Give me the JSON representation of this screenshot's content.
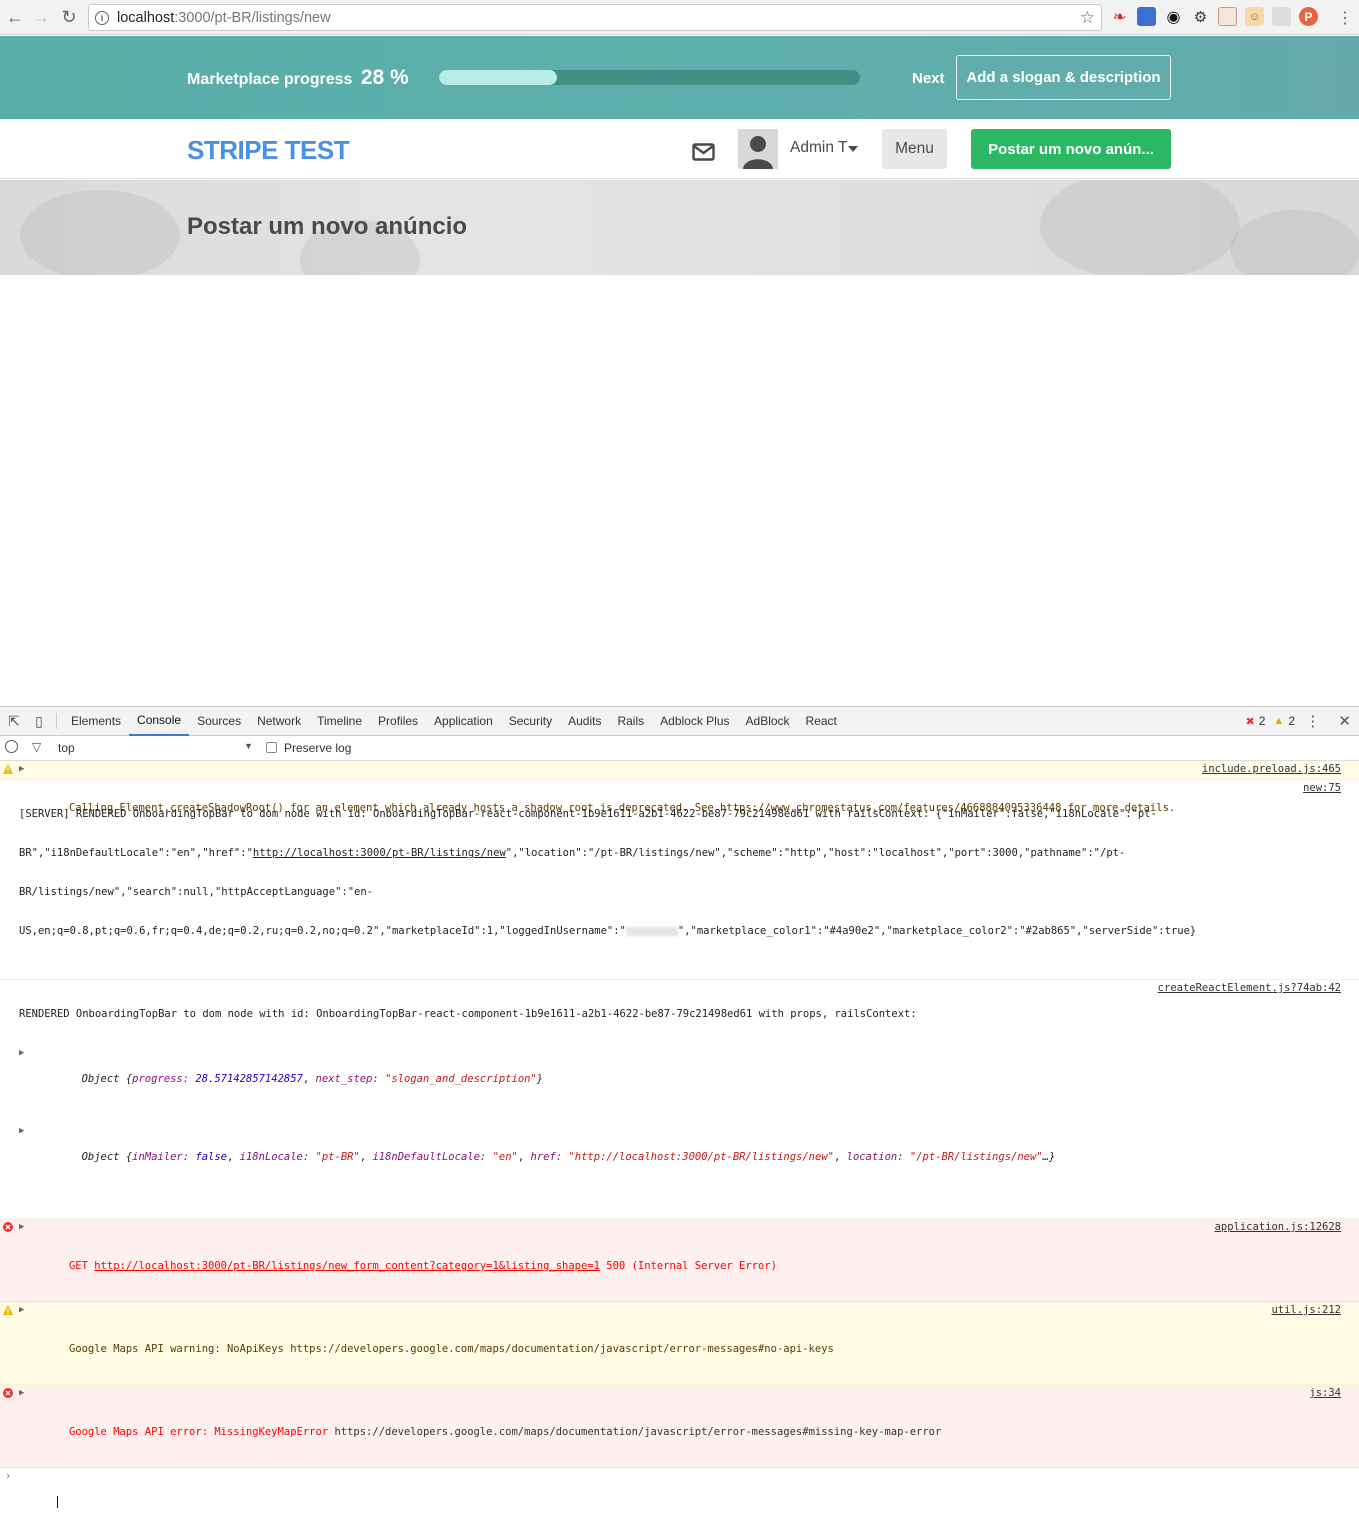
{
  "browser": {
    "url_host": "localhost",
    "url_path": ":3000/pt-BR/listings/new",
    "back_icon": "arrow-left-icon",
    "forward_icon": "arrow-right-icon",
    "reload_icon": "reload-icon",
    "star_icon": "bookmark-star-icon"
  },
  "onboarding": {
    "progress_label": "Marketplace progress",
    "progress_percent_text": "28 %",
    "progress_fraction": 0.28,
    "next_label": "Next",
    "next_step_button": "Add a slogan & description",
    "bar_color": "#58aea8",
    "fill_color": "#b9ece3"
  },
  "topbar": {
    "logo": "STRIPE TEST",
    "logo_color": "#4a90e2",
    "user_name": "Admin T",
    "menu_label": "Menu",
    "post_button": "Postar um novo anún...",
    "post_button_color": "#2ab865"
  },
  "hero": {
    "title": "Postar um novo anúncio"
  },
  "devtools": {
    "tabs": [
      "Elements",
      "Console",
      "Sources",
      "Network",
      "Timeline",
      "Profiles",
      "Application",
      "Security",
      "Audits",
      "Rails",
      "Adblock Plus",
      "AdBlock",
      "React"
    ],
    "active_tab": "Console",
    "error_count": "2",
    "warning_count": "2",
    "context": "top",
    "preserve_log": "Preserve log",
    "messages": {
      "m1": {
        "text": "Calling Element.createShadowRoot() for an element which already hosts a shadow root is deprecated. See https://www.chromestatus.com/features/4668884095336448 for more details.",
        "source": "include.preload.js:465"
      },
      "m2": {
        "line1": "[SERVER] RENDERED OnboardingTopBar to dom node with id: OnboardingTopBar-react-component-1b9e1611-a2b1-4622-be87-79c21498ed61 with railsContext: {\"inMailer\":false,\"i18nLocale\":\"pt-",
        "line2a": "BR\",\"i18nDefaultLocale\":\"en\",\"href\":\"",
        "line2link": "http://localhost:3000/pt-BR/listings/new",
        "line2b": "\",\"location\":\"/pt-BR/listings/new\",\"scheme\":\"http\",\"host\":\"localhost\",\"port\":3000,\"pathname\":\"/pt-",
        "line3": "BR/listings/new\",\"search\":null,\"httpAcceptLanguage\":\"en-",
        "line4a": "US,en;q=0.8,pt;q=0.6,fr;q=0.4,de;q=0.2,ru;q=0.2,no;q=0.2\",\"marketplaceId\":1,\"loggedInUsername\":\"",
        "line4b": "\",\"marketplace_color1\":\"#4a90e2\",\"marketplace_color2\":\"#2ab865\",\"serverSide\":true}",
        "source": "new:75"
      },
      "m3": {
        "text": "RENDERED OnboardingTopBar to dom node with id: OnboardingTopBar-react-component-1b9e1611-a2b1-4622-be87-79c21498ed61 with props, railsContext:",
        "source": "createReactElement.js?74ab:42",
        "obj1_prefix": "Object {",
        "obj1_k1": "progress:",
        "obj1_v1": "28.57142857142857",
        "obj1_k2": "next_step:",
        "obj1_v2": "\"slogan_and_description\"",
        "obj1_suffix": "}",
        "obj2_prefix": "Object {",
        "obj2_k1": "inMailer:",
        "obj2_v1": "false",
        "obj2_k2": "i18nLocale:",
        "obj2_v2": "\"pt-BR\"",
        "obj2_k3": "i18nDefaultLocale:",
        "obj2_v3": "\"en\"",
        "obj2_k4": "href:",
        "obj2_v4": "\"http://localhost:3000/pt-BR/listings/new\"",
        "obj2_k5": "location:",
        "obj2_v5": "\"/pt-BR/listings/new\"",
        "obj2_suffix": "…}"
      },
      "m4": {
        "prefix": "GET ",
        "link": "http://localhost:3000/pt-BR/listings/new_form_content?category=1&listing_shape=1",
        "suffix": " 500 (Internal Server Error)",
        "source": "application.js:12628"
      },
      "m5": {
        "text": "Google Maps API warning: NoApiKeys https://developers.google.com/maps/documentation/javascript/error-messages#no-api-keys",
        "source": "util.js:212"
      },
      "m6": {
        "text_red": "Google Maps API error: MissingKeyMapError ",
        "text_rest": "https://developers.google.com/maps/documentation/javascript/error-messages#missing-key-map-error",
        "source": "js:34"
      }
    }
  }
}
